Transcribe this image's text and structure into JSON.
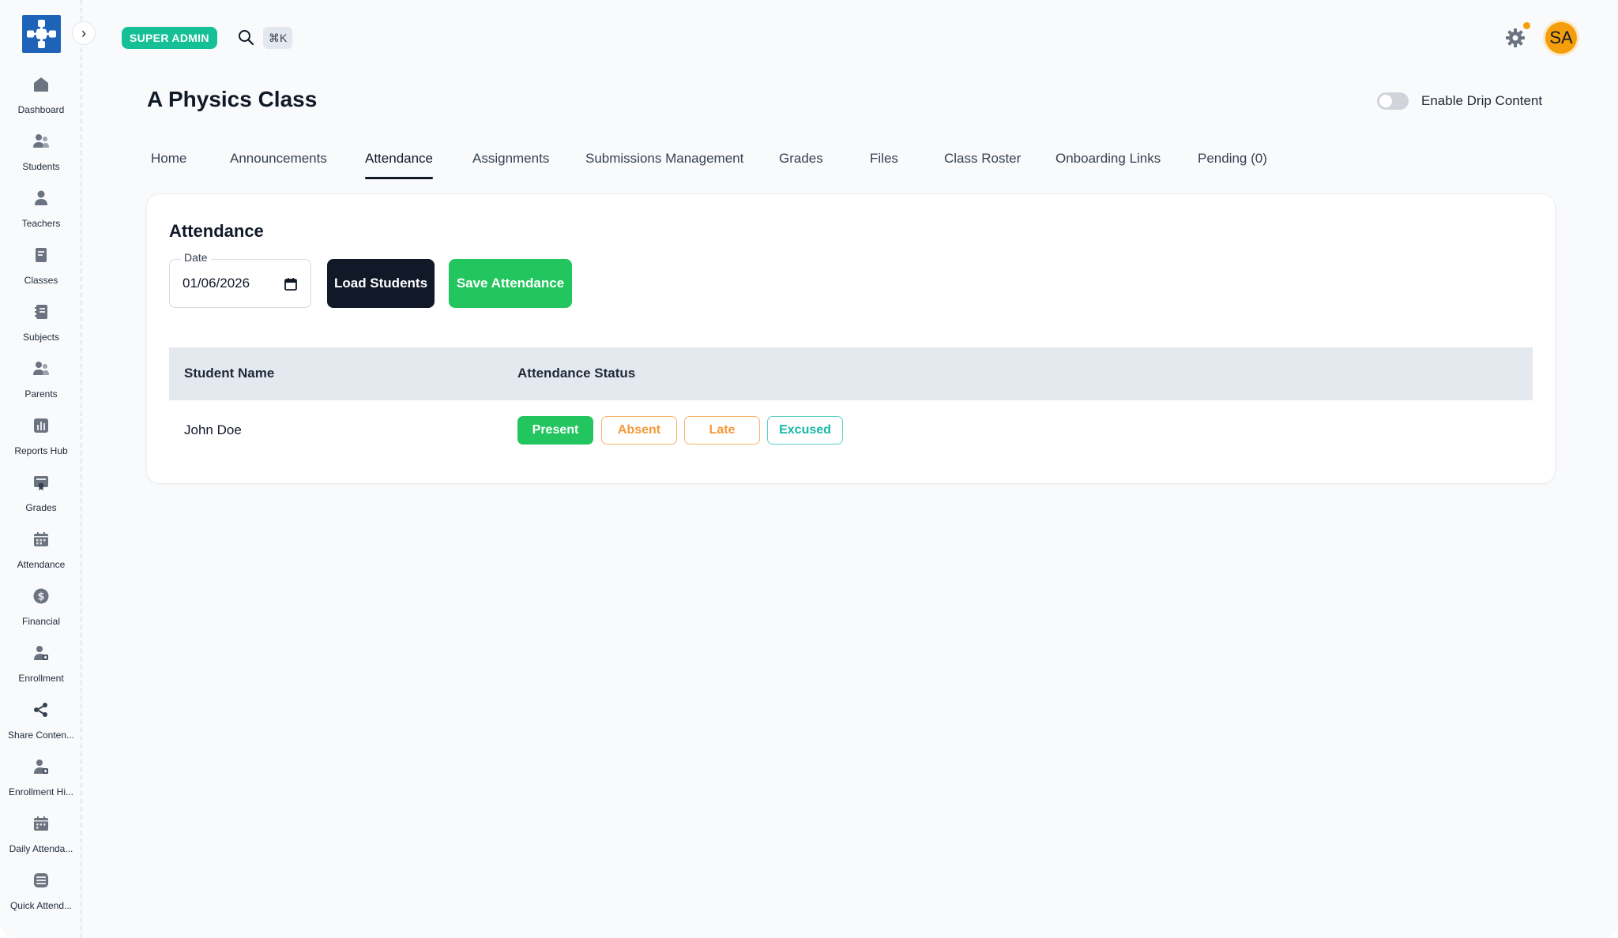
{
  "colors": {
    "brand": "#1e63b8",
    "role_badge": "#16c096",
    "primary_dark": "#111827",
    "success": "#22c55e",
    "warning": "#f39a3a",
    "teal": "#14b8a6",
    "avatar": "#f59e0b"
  },
  "topbar": {
    "role_badge": "SUPER ADMIN",
    "search_shortcut": "⌘K",
    "avatar_initials": "SA",
    "icons": [
      "search-icon",
      "gear-icon",
      "notification-dot"
    ]
  },
  "sidebar": {
    "collapse_glyph": "›",
    "items": [
      {
        "label": "Dashboard",
        "icon": "home-icon"
      },
      {
        "label": "Students",
        "icon": "users-icon"
      },
      {
        "label": "Teachers",
        "icon": "user-icon"
      },
      {
        "label": "Classes",
        "icon": "book-icon"
      },
      {
        "label": "Subjects",
        "icon": "notebook-icon"
      },
      {
        "label": "Parents",
        "icon": "users-icon"
      },
      {
        "label": "Reports Hub",
        "icon": "bar-chart-icon"
      },
      {
        "label": "Grades",
        "icon": "certificate-icon"
      },
      {
        "label": "Attendance",
        "icon": "calendar-icon"
      },
      {
        "label": "Financial",
        "icon": "dollar-icon"
      },
      {
        "label": "Enrollment",
        "icon": "user-add-icon"
      },
      {
        "label": "Share Conten...",
        "icon": "share-icon"
      },
      {
        "label": "Enrollment Hi...",
        "icon": "user-add-icon"
      },
      {
        "label": "Daily Attenda...",
        "icon": "calendar-icon"
      },
      {
        "label": "Quick Attend...",
        "icon": "list-check-icon"
      }
    ]
  },
  "header": {
    "title": "A Physics Class",
    "drip_toggle_label": "Enable Drip Content",
    "drip_enabled": false
  },
  "tabs": [
    {
      "label": "Home",
      "active": false
    },
    {
      "label": "Announcements",
      "active": false
    },
    {
      "label": "Attendance",
      "active": true
    },
    {
      "label": "Assignments",
      "active": false
    },
    {
      "label": "Submissions Management",
      "active": false
    },
    {
      "label": "Grades",
      "active": false
    },
    {
      "label": "Files",
      "active": false
    },
    {
      "label": "Class Roster",
      "active": false
    },
    {
      "label": "Onboarding Links",
      "active": false
    },
    {
      "label": "Pending (0)",
      "active": false
    }
  ],
  "attendance": {
    "title": "Attendance",
    "date_label": "Date",
    "date_value": "01/06/2026",
    "load_button": "Load Students",
    "save_button": "Save Attendance",
    "columns": [
      "Student Name",
      "Attendance Status"
    ],
    "rows": [
      {
        "name": "John Doe",
        "selected_status": "Present"
      }
    ],
    "status_options": [
      "Present",
      "Absent",
      "Late",
      "Excused"
    ]
  }
}
